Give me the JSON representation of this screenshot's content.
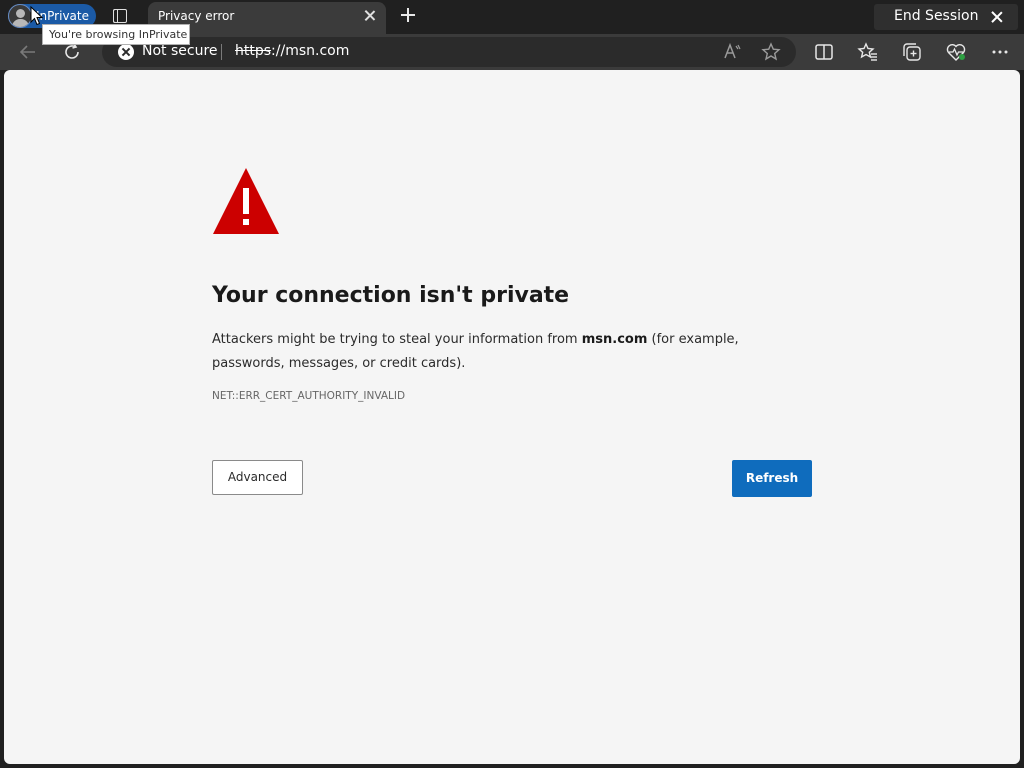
{
  "browser": {
    "inprivate_label": "InPrivate",
    "inprivate_tooltip": "You're browsing InPrivate",
    "tab_title": "Privacy error",
    "end_session_label": "End Session",
    "security_label": "Not secure",
    "url_scheme": "https",
    "url_rest": "://msn.com",
    "icons": [
      "avatar",
      "tab-actions-icon",
      "close-icon",
      "plus-icon",
      "back-arrow-icon",
      "refresh-icon",
      "not-secure-icon",
      "read-aloud-icon",
      "star-icon",
      "split-screen-icon",
      "favorites-icon",
      "collections-icon",
      "browser-essentials-icon",
      "more-icon"
    ]
  },
  "page": {
    "title": "Your connection isn't private",
    "desc_before": "Attackers might be trying to steal your information from ",
    "desc_site": "msn.com",
    "desc_after": " (for example, passwords, messages, or credit cards).",
    "error_code": "NET::ERR_CERT_AUTHORITY_INVALID",
    "advanced_label": "Advanced",
    "refresh_label": "Refresh"
  },
  "colors": {
    "accent": "#0f6cbd",
    "warning": "#cc0000",
    "inprivate": "#1b5aa6"
  }
}
